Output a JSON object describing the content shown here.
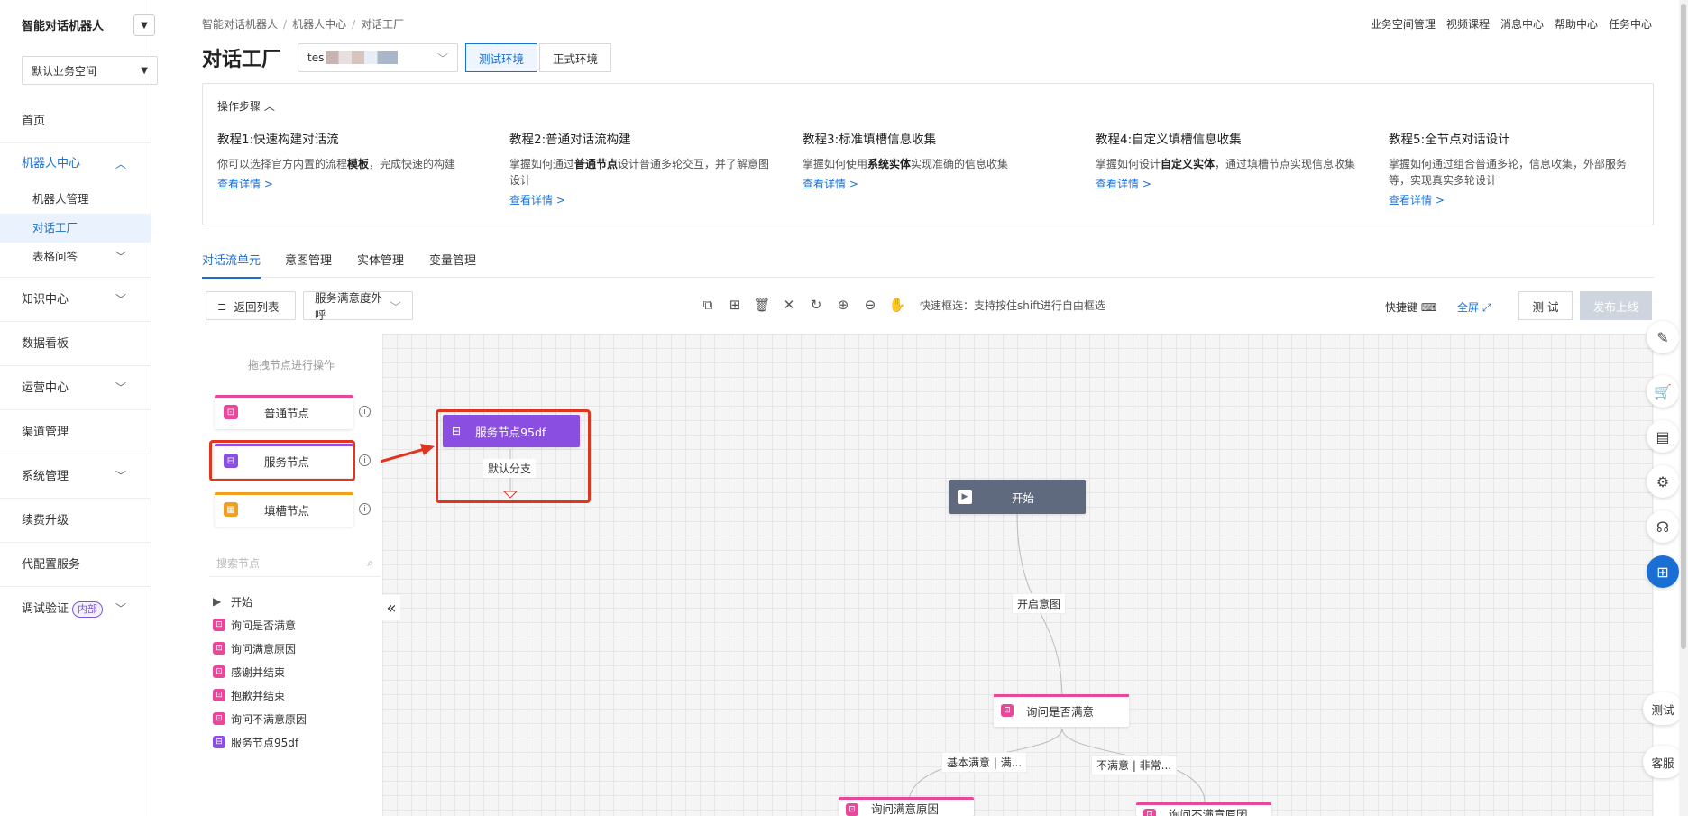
{
  "sidebar": {
    "brand": "智能对话机器人",
    "workspace": "默认业务空间",
    "items": [
      {
        "label": "首页"
      },
      {
        "label": "机器人中心",
        "children": [
          "机器人管理",
          "对话工厂",
          "表格问答"
        ]
      },
      {
        "label": "知识中心"
      },
      {
        "label": "数据看板"
      },
      {
        "label": "运营中心"
      },
      {
        "label": "渠道管理"
      },
      {
        "label": "系统管理"
      },
      {
        "label": "续费升级"
      },
      {
        "label": "代配置服务"
      },
      {
        "label": "调试验证",
        "tag": "内部"
      }
    ]
  },
  "header": {
    "breadcrumb": [
      "智能对话机器人",
      "机器人中心",
      "对话工厂"
    ],
    "topnav": [
      "业务空间管理",
      "视频课程",
      "消息中心",
      "帮助中心",
      "任务中心"
    ],
    "title": "对话工厂",
    "bot_select": "tes",
    "env_test": "测试环境",
    "env_prod": "正式环境"
  },
  "steps": {
    "title": "操作步骤",
    "items": [
      {
        "title": "教程1:快速构建对话流",
        "desc_pre": "你可以选择官方内置的流程",
        "desc_bold": "模板",
        "desc_post": "，完成快速的构建",
        "more": "查看详情 >"
      },
      {
        "title": "教程2:普通对话流构建",
        "desc_pre": "掌握如何通过",
        "desc_bold": "普通节点",
        "desc_post": "设计普通多轮交互，并了解意图设计",
        "more": "查看详情 >"
      },
      {
        "title": "教程3:标准填槽信息收集",
        "desc_pre": "掌握如何使用",
        "desc_bold": "系统实体",
        "desc_post": "实现准确的信息收集",
        "more": "查看详情 >"
      },
      {
        "title": "教程4:自定义填槽信息收集",
        "desc_pre": "掌握如何设计",
        "desc_bold": "自定义实体",
        "desc_post": "，通过填槽节点实现信息收集",
        "more": "查看详情 >"
      },
      {
        "title": "教程5:全节点对话设计",
        "desc_pre": "掌握如何通过组合普通多轮，信息收集，外部服务等，实现真实多轮设计",
        "desc_bold": "",
        "desc_post": "",
        "more": "查看详情 >"
      }
    ]
  },
  "tabs": [
    "对话流单元",
    "意图管理",
    "实体管理",
    "变量管理"
  ],
  "toolbar": {
    "back": "返回列表",
    "flow_select": "服务满意度外呼",
    "hint": "快速框选：支持按住shift进行自由框选",
    "shortcut": "快捷键",
    "fullscreen": "全屏",
    "test": "测 试",
    "publish": "发布上线"
  },
  "palette": {
    "hint": "拖拽节点进行操作",
    "nodes": [
      {
        "label": "普通节点",
        "color": "#e8489a"
      },
      {
        "label": "服务节点",
        "color": "#8a4fe0"
      },
      {
        "label": "填槽节点",
        "color": "#f0a020"
      }
    ],
    "search_placeholder": "搜索节点",
    "tree": [
      {
        "label": "开始",
        "type": "start"
      },
      {
        "label": "询问是否满意",
        "type": "normal"
      },
      {
        "label": "询问满意原因",
        "type": "normal"
      },
      {
        "label": "感谢并结束",
        "type": "normal"
      },
      {
        "label": "抱歉并结束",
        "type": "normal"
      },
      {
        "label": "询问不满意原因",
        "type": "normal"
      },
      {
        "label": "服务节点95df",
        "type": "service"
      }
    ]
  },
  "flow": {
    "service_node": "服务节点95df",
    "default_branch": "默认分支",
    "start": "开始",
    "edge_open_intent": "开启意图",
    "ask_satisfied": "询问是否满意",
    "edge_satisfied": "基本满意 | 满...",
    "edge_unsatisfied": "不满意 | 非常...",
    "ask_reason": "询问满意原因",
    "ask_unsat_reason": "询问不满意原因"
  },
  "float": {
    "test": "测试",
    "service": "客服"
  },
  "colors": {
    "primary": "#1a6fd4",
    "normal_node": "#e8489a",
    "service_node": "#8a4fe0",
    "slot_node": "#f0a020",
    "annotation": "#e0351f",
    "start_node": "#5f6a7e"
  }
}
